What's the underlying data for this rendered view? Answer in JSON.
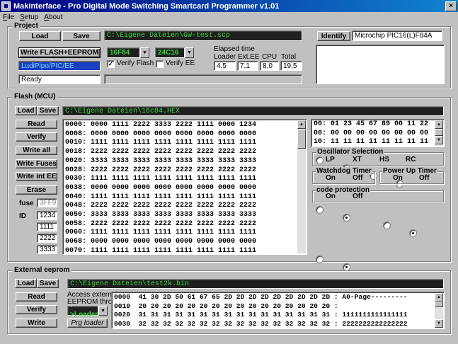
{
  "window": {
    "title": "Makinterface - Pro Digital Mode Switching Smartcard Programmer v1.01",
    "close_glyph": "×"
  },
  "menu": [
    "File",
    "Setup",
    "About"
  ],
  "project": {
    "label": "Project",
    "load": "Load",
    "save": "Save",
    "path": "C:\\Eigene Dateien\\GW-test.scp",
    "write_flash_eeprom": "Write FLASH+EEPROM",
    "device_flash": "16F84",
    "device_ee": "24C16",
    "interface": "LudiPipo/PIC/EE",
    "verify_flash": "Verify Flash",
    "verify_flash_checked": true,
    "verify_ee": "Verify EE",
    "verify_ee_checked": false,
    "status": "Ready",
    "elapsed": {
      "title": "Elapsed time",
      "headers": [
        "Loader",
        "Ext.EE",
        "CPU",
        "Total"
      ],
      "values": [
        "4,5",
        "7,1",
        "8,0",
        "19,5"
      ]
    },
    "identify": "Identify",
    "chip_id": "Microchip PIC16(L)F84A"
  },
  "flash": {
    "label": "Flash (MCU)",
    "load": "Load",
    "save": "Save",
    "path": "C:\\Eigene Dateien\\16c84.HEX",
    "buttons": [
      "Read",
      "Verify",
      "Write all",
      "Write Fuses",
      "Write int EE",
      "Erase"
    ],
    "fuse_label": "fuse",
    "fuse_value": "3FF9",
    "id_label": "ID",
    "ids": [
      "1234",
      "1111",
      "2222",
      "3333"
    ],
    "hex_lines": [
      "0000: 0000 1111 2222 3333 2222 1111 0000 1234",
      "0008: 0000 0000 0000 0000 0000 0000 0000 0000",
      "0010: 1111 1111 1111 1111 1111 1111 1111 1111",
      "0018: 2222 2222 2222 2222 2222 2222 2222 2222",
      "0020: 3333 3333 3333 3333 3333 3333 3333 3333",
      "0028: 2222 2222 2222 2222 2222 2222 2222 2222",
      "0030: 1111 1111 1111 1111 1111 1111 1111 1111",
      "0038: 0000 0000 0000 0000 0000 0000 0000 0000",
      "0040: 1111 1111 1111 1111 1111 1111 1111 1111",
      "0048: 2222 2222 2222 2222 2222 2222 2222 2222",
      "0050: 3333 3333 3333 3333 3333 3333 3333 3333",
      "0058: 2222 2222 2222 2222 2222 2222 2222 2222",
      "0060: 1111 1111 1111 1111 1111 1111 1111 1111",
      "0068: 0000 0000 0000 0000 0000 0000 0000 0000",
      "0070: 1111 1111 1111 1111 1111 1111 1111 1111"
    ],
    "ee_lines": [
      "00: 01 23 45 67 89 00 11 22",
      "08: 00 00 00 00 00 00 00 00",
      "10: 11 11 11 11 11 11 11 11"
    ],
    "osc": {
      "title": "Oscillator Selection",
      "options": [
        "LP",
        "XT",
        "HS",
        "RC"
      ],
      "selected": "XT"
    },
    "wdt": {
      "title": "Watchdog Timer",
      "options": [
        "On",
        "Off"
      ],
      "selected": "Off"
    },
    "pwrt": {
      "title": "Power Up Timer",
      "options": [
        "On",
        "Off"
      ],
      "selected": "Off"
    },
    "cp": {
      "title": "code protection",
      "options": [
        "On",
        "Off"
      ],
      "selected": "Off"
    }
  },
  "ext": {
    "label": "External eeprom",
    "load": "Load",
    "save": "Save",
    "path": "C:\\Eigene Dateien\\test2k.bin",
    "buttons": [
      "Read",
      "Verify",
      "Write"
    ],
    "access_line1": "Access external",
    "access_line2": "EEPROM throu",
    "access_combo": "->Loader",
    "prg_loader": "Prg loader",
    "hex_lines": [
      "0000  41 30 2D 50 61 67 65 2D 2D 2D 2D 2D 2D 2D 2D 2D : A0-Page---------",
      "0010  20 20 20 20 20 20 20 20 20 20 20 20 20 20 20 20 :",
      "0020  31 31 31 31 31 31 31 31 31 31 31 31 31 31 31 31 : 1111111111111111",
      "0030  32 32 32 32 32 32 32 32 32 32 32 32 32 32 32 32 : 2222222222222222"
    ]
  }
}
